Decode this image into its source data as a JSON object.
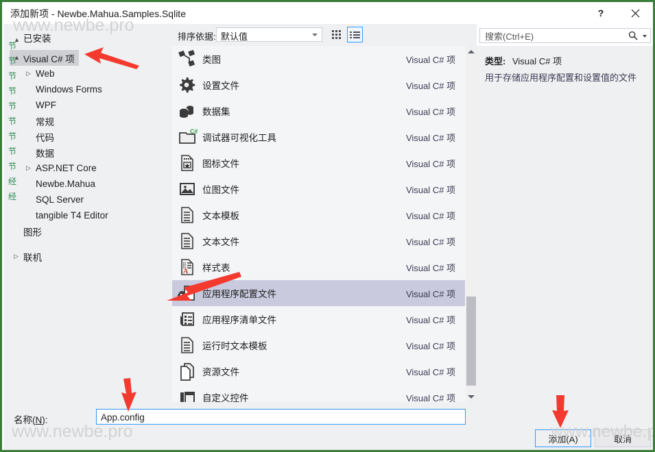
{
  "window": {
    "title": "添加新项 - Newbe.Mahua.Samples.Sqlite",
    "help_label": "?",
    "close_label": "✕"
  },
  "sidebar": {
    "root_label": "已安装",
    "items": [
      {
        "label": "Visual C# 项",
        "level": 0,
        "caret": "▲",
        "selected": true
      },
      {
        "label": "Web",
        "level": 1,
        "caret": "▷",
        "selected": false
      },
      {
        "label": "Windows Forms",
        "level": 1,
        "caret": "",
        "selected": false
      },
      {
        "label": "WPF",
        "level": 1,
        "caret": "",
        "selected": false
      },
      {
        "label": "常规",
        "level": 1,
        "caret": "",
        "selected": false
      },
      {
        "label": "代码",
        "level": 1,
        "caret": "",
        "selected": false
      },
      {
        "label": "数据",
        "level": 1,
        "caret": "",
        "selected": false
      },
      {
        "label": "ASP.NET Core",
        "level": 1,
        "caret": "▷",
        "selected": false
      },
      {
        "label": "Newbe.Mahua",
        "level": 1,
        "caret": "",
        "selected": false
      },
      {
        "label": "SQL Server",
        "level": 1,
        "caret": "",
        "selected": false
      },
      {
        "label": "tangible T4 Editor",
        "level": 1,
        "caret": "",
        "selected": false
      },
      {
        "label": "图形",
        "level": 0,
        "caret": "",
        "selected": false
      },
      {
        "label": "联机",
        "level": 0,
        "caret": "▷",
        "selected": false
      }
    ]
  },
  "toolbar": {
    "sort_label": "排序依据:",
    "sort_value": "默认值",
    "grid_view_icon": "grid-view-icon",
    "list_view_icon": "list-view-icon"
  },
  "search": {
    "placeholder": "搜索(Ctrl+E)",
    "value": "",
    "icon": "search-icon"
  },
  "items": [
    {
      "name": "类图",
      "kind": "Visual C# 项",
      "icon": "class-diagram-icon",
      "selected": false
    },
    {
      "name": "设置文件",
      "kind": "Visual C# 项",
      "icon": "gear-icon",
      "selected": false
    },
    {
      "name": "数据集",
      "kind": "Visual C# 项",
      "icon": "database-icon",
      "selected": false
    },
    {
      "name": "调试器可视化工具",
      "kind": "Visual C# 项",
      "icon": "folder-csharp-icon",
      "selected": false
    },
    {
      "name": "图标文件",
      "kind": "Visual C# 项",
      "icon": "icon-file-icon",
      "selected": false
    },
    {
      "name": "位图文件",
      "kind": "Visual C# 项",
      "icon": "bitmap-file-icon",
      "selected": false
    },
    {
      "name": "文本模板",
      "kind": "Visual C# 项",
      "icon": "text-document-icon",
      "selected": false
    },
    {
      "name": "文本文件",
      "kind": "Visual C# 项",
      "icon": "text-document-icon",
      "selected": false
    },
    {
      "name": "样式表",
      "kind": "Visual C# 项",
      "icon": "stylesheet-icon",
      "selected": false
    },
    {
      "name": "应用程序配置文件",
      "kind": "Visual C# 项",
      "icon": "app-config-icon",
      "selected": true
    },
    {
      "name": "应用程序清单文件",
      "kind": "Visual C# 项",
      "icon": "app-manifest-icon",
      "selected": false
    },
    {
      "name": "运行时文本模板",
      "kind": "Visual C# 项",
      "icon": "text-document-icon",
      "selected": false
    },
    {
      "name": "资源文件",
      "kind": "Visual C# 项",
      "icon": "resource-file-icon",
      "selected": false
    },
    {
      "name": "自定义控件",
      "kind": "Visual C# 项",
      "icon": "custom-control-icon",
      "selected": false
    }
  ],
  "details": {
    "type_label": "类型:",
    "type_value": "Visual C# 项",
    "description": "用于存储应用程序配置和设置值的文件"
  },
  "footer": {
    "name_label_prefix": "名称(",
    "name_label_key": "N",
    "name_label_suffix": "):",
    "name_value": "App.config",
    "add_label": "添加(A)",
    "cancel_label": "取消"
  },
  "watermarks": {
    "top": "www.newbe.pro",
    "bottom_left": "www.newbe.pro",
    "bottom_right": "www.newbe.pro"
  },
  "colors": {
    "selection": "#c9cade",
    "tree_selection": "#cfd0d4",
    "accent_border": "#3399ff",
    "panel_bg": "#eff0f2",
    "list_bg": "#f4f5f7",
    "annotation_red": "#f4392f",
    "window_border": "#3a7d3a"
  }
}
